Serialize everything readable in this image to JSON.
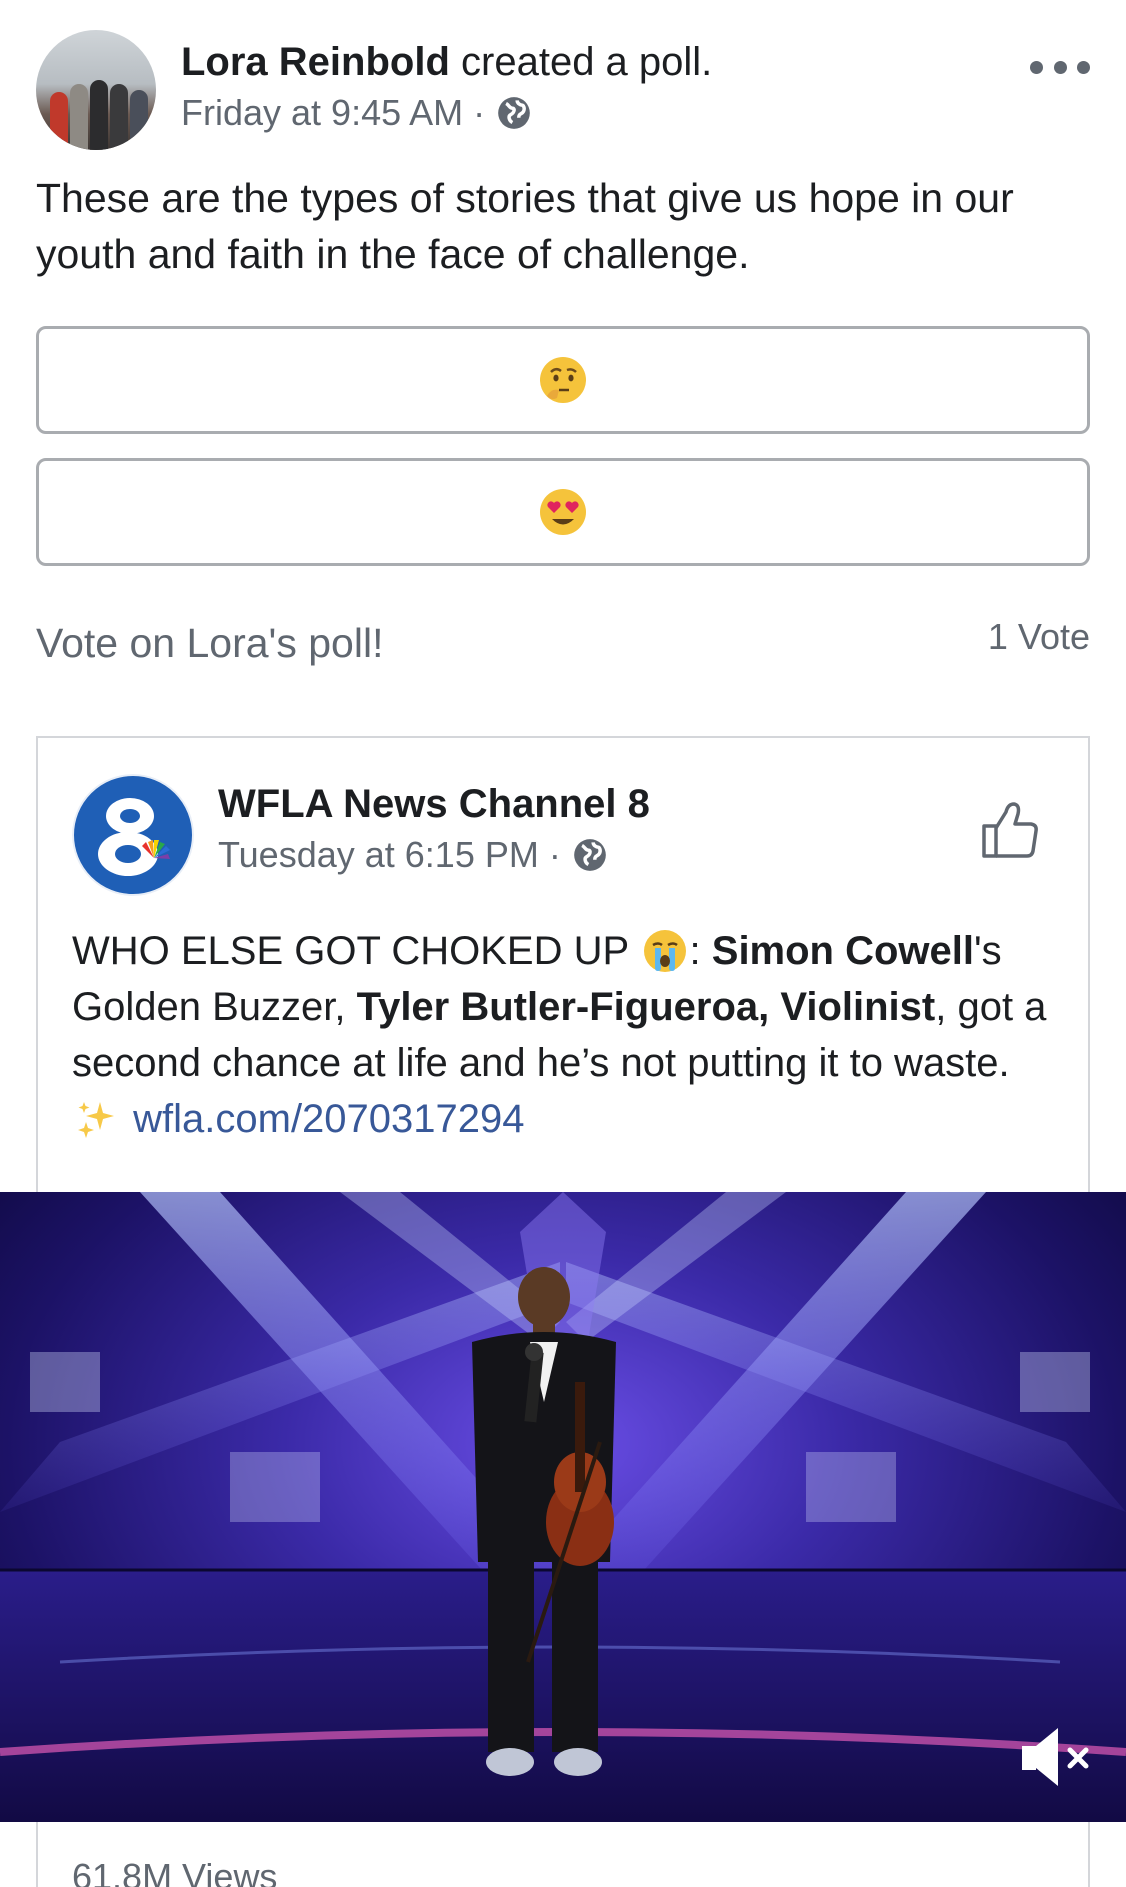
{
  "poll_post": {
    "author": "Lora Reinbold",
    "action": "created a poll.",
    "timestamp": "Friday at 9:45 AM",
    "separator": "·",
    "privacy_icon": "globe-icon",
    "more_icon": "more-options-icon",
    "text": "These are the types of stories that give us hope in our youth and faith in the face of challenge.",
    "options": [
      {
        "emoji": "thinking-face-emoji"
      },
      {
        "emoji": "heart-eyes-emoji"
      }
    ],
    "vote_prompt": "Vote on Lora's poll!",
    "vote_count": "1 Vote"
  },
  "shared_post": {
    "page_name": "WFLA News Channel 8",
    "timestamp": "Tuesday at 6:15 PM",
    "separator": "·",
    "privacy_icon": "globe-icon",
    "like_icon": "like-icon",
    "text": {
      "part1": "WHO ELSE GOT CHOKED UP",
      "part2": ": ",
      "bold1": "Simon Cowell",
      "part3": "'s Golden Buzzer, ",
      "bold2": "Tyler Butler-Figueroa, Violinist",
      "part4": ", got a second chance at life and he’s not putting it to waste. ",
      "link": "wfla.com/2070317294"
    },
    "video": {
      "mute_icon": "speaker-muted-icon"
    },
    "views": "61.8M Views"
  },
  "colors": {
    "text": "#1c1e21",
    "secondary_text": "#606770",
    "link": "#385898",
    "border": "#a9acb0"
  }
}
